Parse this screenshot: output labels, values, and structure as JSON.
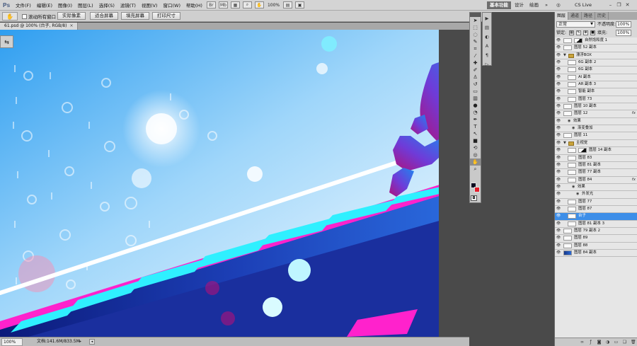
{
  "app": {
    "logo": "Ps",
    "menu": [
      "文件(F)",
      "编辑(E)",
      "图像(I)",
      "图层(L)",
      "选择(S)",
      "滤镜(T)",
      "视图(V)",
      "窗口(W)",
      "帮助(H)"
    ],
    "zoom_readout": "100%",
    "workspace_active": "基本功能",
    "workspace_design": "设计",
    "workspace_painting": "绘画",
    "workspace_more": "»",
    "cs_live": "CS Live"
  },
  "options_bar": {
    "scroll_all_label": "滚动所有窗口",
    "scroll_all_checked": false,
    "buttons": [
      "实际像素",
      "适合屏幕",
      "填充屏幕",
      "打印尺寸"
    ]
  },
  "document": {
    "tab_title": "61.psd @ 100% (台子, RGB/8)",
    "tab_close": "×"
  },
  "statusbar": {
    "zoom": "100%",
    "doc_info": "文档:141.6M/833.5M"
  },
  "tools": [
    "move-tool",
    "marquee-tool",
    "lasso-tool",
    "quick-select-tool",
    "crop-tool",
    "eyedropper-tool",
    "healing-tool",
    "brush-tool",
    "clone-stamp-tool",
    "history-brush-tool",
    "eraser-tool",
    "gradient-tool",
    "blur-tool",
    "dodge-tool",
    "pen-tool",
    "type-tool",
    "path-select-tool",
    "shape-tool",
    "3d-rotate-tool",
    "3d-orbit-tool",
    "hand-tool",
    "zoom-tool"
  ],
  "colors": {
    "foreground": "#0a0a20",
    "background": "#e31b2a",
    "selection": "#3d8ee8",
    "accent_pink": "#ff22cc",
    "accent_cyan": "#2ff0ff"
  },
  "layers_panel": {
    "tabs": [
      "图层",
      "通道",
      "路径",
      "历史"
    ],
    "blend_mode": "正常",
    "opacity_label": "不透明度:",
    "opacity_value": "100%",
    "lock_label": "锁定:",
    "fill_label": "填充:",
    "fill_value": "100%",
    "layers": [
      {
        "name": "自然饱和度 1",
        "kind": "adjustment",
        "indent": 0,
        "visible": true
      },
      {
        "name": "图层 52 副本",
        "kind": "layer",
        "indent": 0,
        "visible": true
      },
      {
        "name": "漂浮BOX",
        "kind": "group",
        "indent": 0,
        "visible": true
      },
      {
        "name": "6G 副本 2",
        "kind": "layer",
        "indent": 1,
        "visible": true
      },
      {
        "name": "6G 副本",
        "kind": "layer",
        "indent": 1,
        "visible": true
      },
      {
        "name": "AI 副本",
        "kind": "layer",
        "indent": 1,
        "visible": true
      },
      {
        "name": "AR 副本 3",
        "kind": "layer",
        "indent": 1,
        "visible": true
      },
      {
        "name": "智能 副本",
        "kind": "layer",
        "indent": 1,
        "visible": true
      },
      {
        "name": "图层 73",
        "kind": "layer",
        "indent": 1,
        "visible": true
      },
      {
        "name": "图层 10 副本",
        "kind": "layer",
        "indent": 0,
        "visible": true
      },
      {
        "name": "图层 12",
        "kind": "layer",
        "indent": 0,
        "visible": true,
        "fx": true
      },
      {
        "name": "效果",
        "kind": "effects",
        "indent": 1,
        "visible": true
      },
      {
        "name": "渐变叠加",
        "kind": "effect",
        "indent": 2,
        "visible": true
      },
      {
        "name": "图层 11",
        "kind": "layer",
        "indent": 0,
        "visible": true
      },
      {
        "name": "主视觉",
        "kind": "group",
        "indent": 0,
        "visible": true
      },
      {
        "name": "图层 14 副本",
        "kind": "masked",
        "indent": 1,
        "visible": true
      },
      {
        "name": "图层 83",
        "kind": "layer",
        "indent": 1,
        "visible": true
      },
      {
        "name": "图层 81 副本",
        "kind": "layer",
        "indent": 1,
        "visible": true
      },
      {
        "name": "图层 77 副本",
        "kind": "layer",
        "indent": 1,
        "visible": true
      },
      {
        "name": "图层 84",
        "kind": "layer",
        "indent": 1,
        "visible": true,
        "fx": true
      },
      {
        "name": "效果",
        "kind": "effects",
        "indent": 2,
        "visible": true
      },
      {
        "name": "外发光",
        "kind": "effect",
        "indent": 3,
        "visible": true
      },
      {
        "name": "图层 77",
        "kind": "layer",
        "indent": 1,
        "visible": true
      },
      {
        "name": "图层 87",
        "kind": "layer",
        "indent": 1,
        "visible": true
      },
      {
        "name": "台子",
        "kind": "selected",
        "indent": 1,
        "visible": true
      },
      {
        "name": "图层 81 副本 3",
        "kind": "layer",
        "indent": 1,
        "visible": true
      },
      {
        "name": "图层 79 副本 2",
        "kind": "layer",
        "indent": 0,
        "visible": true
      },
      {
        "name": "图层 89",
        "kind": "layer",
        "indent": 0,
        "visible": true
      },
      {
        "name": "图层 88",
        "kind": "layer",
        "indent": 0,
        "visible": true
      },
      {
        "name": "图层 84 副本",
        "kind": "dark",
        "indent": 0,
        "visible": true
      }
    ]
  }
}
